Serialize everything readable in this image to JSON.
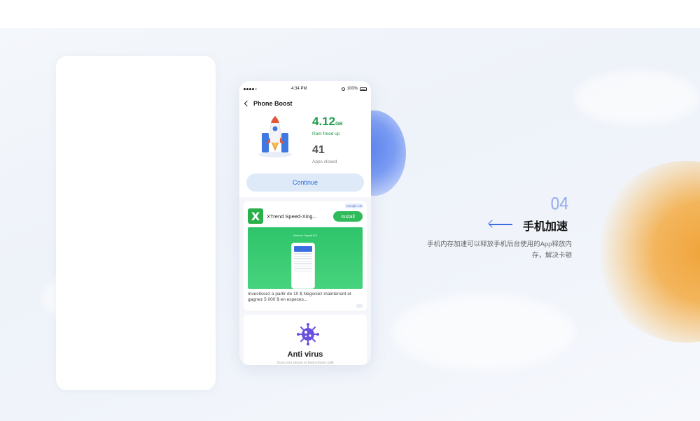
{
  "phone": {
    "status_time": "4:34 PM",
    "battery": "100%",
    "header_title": "Phone Boost",
    "ram_value": "4.12",
    "ram_unit": "GB",
    "ram_label": "Ram freed up",
    "apps_value": "41",
    "apps_label": "Apps closed",
    "continue_label": "Continue"
  },
  "ad": {
    "tag": "Google AD",
    "app_name": "XTrend Speed-Xing...",
    "install_label": "Install",
    "image_caption": "Minimum Deposit $10",
    "description": "Investissez a partir de 10 $ Negociez maintenant et gagnez  5 000 $ en especes..."
  },
  "antivirus": {
    "title": "Anti virus",
    "subtitle": "Scan your phone to keep phone safe"
  },
  "feature": {
    "number": "04",
    "title": "手机加速",
    "description": "手机内存加速可以释放手机后台使用的App释放内存，解决卡顿"
  },
  "colors": {
    "accent_blue": "#3a6de0",
    "ram_green": "#1f9b49",
    "install_green": "#2fbb5a",
    "blob_orange": "#f0a43a"
  }
}
